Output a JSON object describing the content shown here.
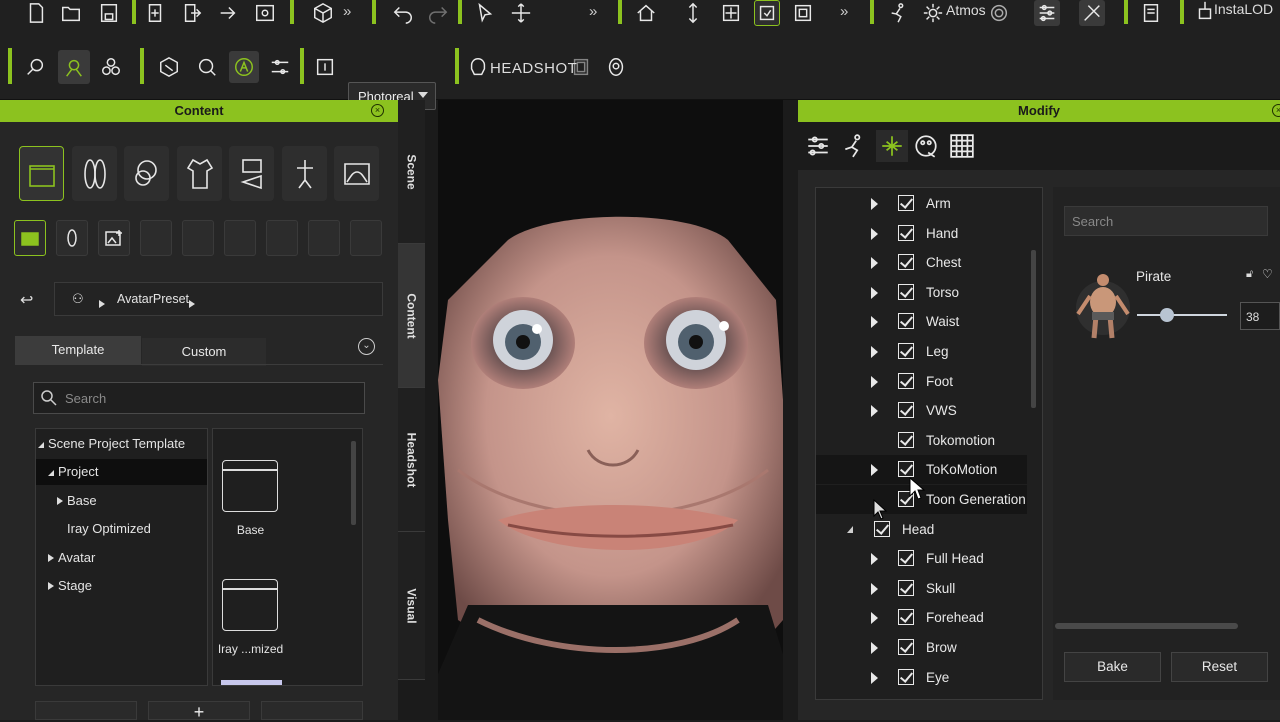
{
  "toolbar": {
    "atmos_label": "Atmos",
    "instalod_label": "InstaLOD",
    "render_mode": "Photoreal",
    "headshot_label": "HEADSHOT"
  },
  "content_panel": {
    "title": "Content",
    "breadcrumb": "AvatarPreset",
    "tabs": [
      "Template",
      "Custom"
    ],
    "active_tab": "Template",
    "search_placeholder": "Search",
    "tree": [
      {
        "label": "Scene Project Template",
        "expanded": true
      },
      {
        "label": "Project",
        "expanded": true,
        "selected": true
      },
      {
        "label": "Base",
        "expanded": false
      },
      {
        "label": "Iray Optimized"
      },
      {
        "label": "Avatar",
        "expanded": false
      },
      {
        "label": "Stage",
        "expanded": false
      }
    ],
    "thumbnails": [
      "Base",
      "Iray ...mized"
    ]
  },
  "side_tabs": [
    "Scene",
    "Content",
    "Headshot",
    "Visual"
  ],
  "modify_panel": {
    "title": "Modify",
    "morph_list": [
      {
        "label": "Arm",
        "checked": true,
        "arrow": true
      },
      {
        "label": "Hand",
        "checked": true,
        "arrow": true
      },
      {
        "label": "Chest",
        "checked": true,
        "arrow": true
      },
      {
        "label": "Torso",
        "checked": true,
        "arrow": true
      },
      {
        "label": "Waist",
        "checked": true,
        "arrow": true
      },
      {
        "label": "Leg",
        "checked": true,
        "arrow": true
      },
      {
        "label": "Foot",
        "checked": true,
        "arrow": true
      },
      {
        "label": "VWS",
        "checked": true,
        "arrow": true
      },
      {
        "label": "Tokomotion",
        "checked": true,
        "arrow": false
      },
      {
        "label": "ToKoMotion",
        "checked": true,
        "arrow": true
      },
      {
        "label": "Toon Generation",
        "checked": true,
        "arrow": false
      },
      {
        "label": "Head",
        "checked": true,
        "arrow": false,
        "expanded": true
      },
      {
        "label": "Full Head",
        "checked": true,
        "arrow": true
      },
      {
        "label": "Skull",
        "checked": true,
        "arrow": true
      },
      {
        "label": "Forehead",
        "checked": true,
        "arrow": true
      },
      {
        "label": "Brow",
        "checked": true,
        "arrow": true
      },
      {
        "label": "Eye",
        "checked": true,
        "arrow": true
      }
    ],
    "search_placeholder": "Search",
    "morph_item": {
      "name": "Pirate",
      "value": "38",
      "slider_fraction": 0.33
    },
    "bake_label": "Bake",
    "reset_label": "Reset"
  }
}
